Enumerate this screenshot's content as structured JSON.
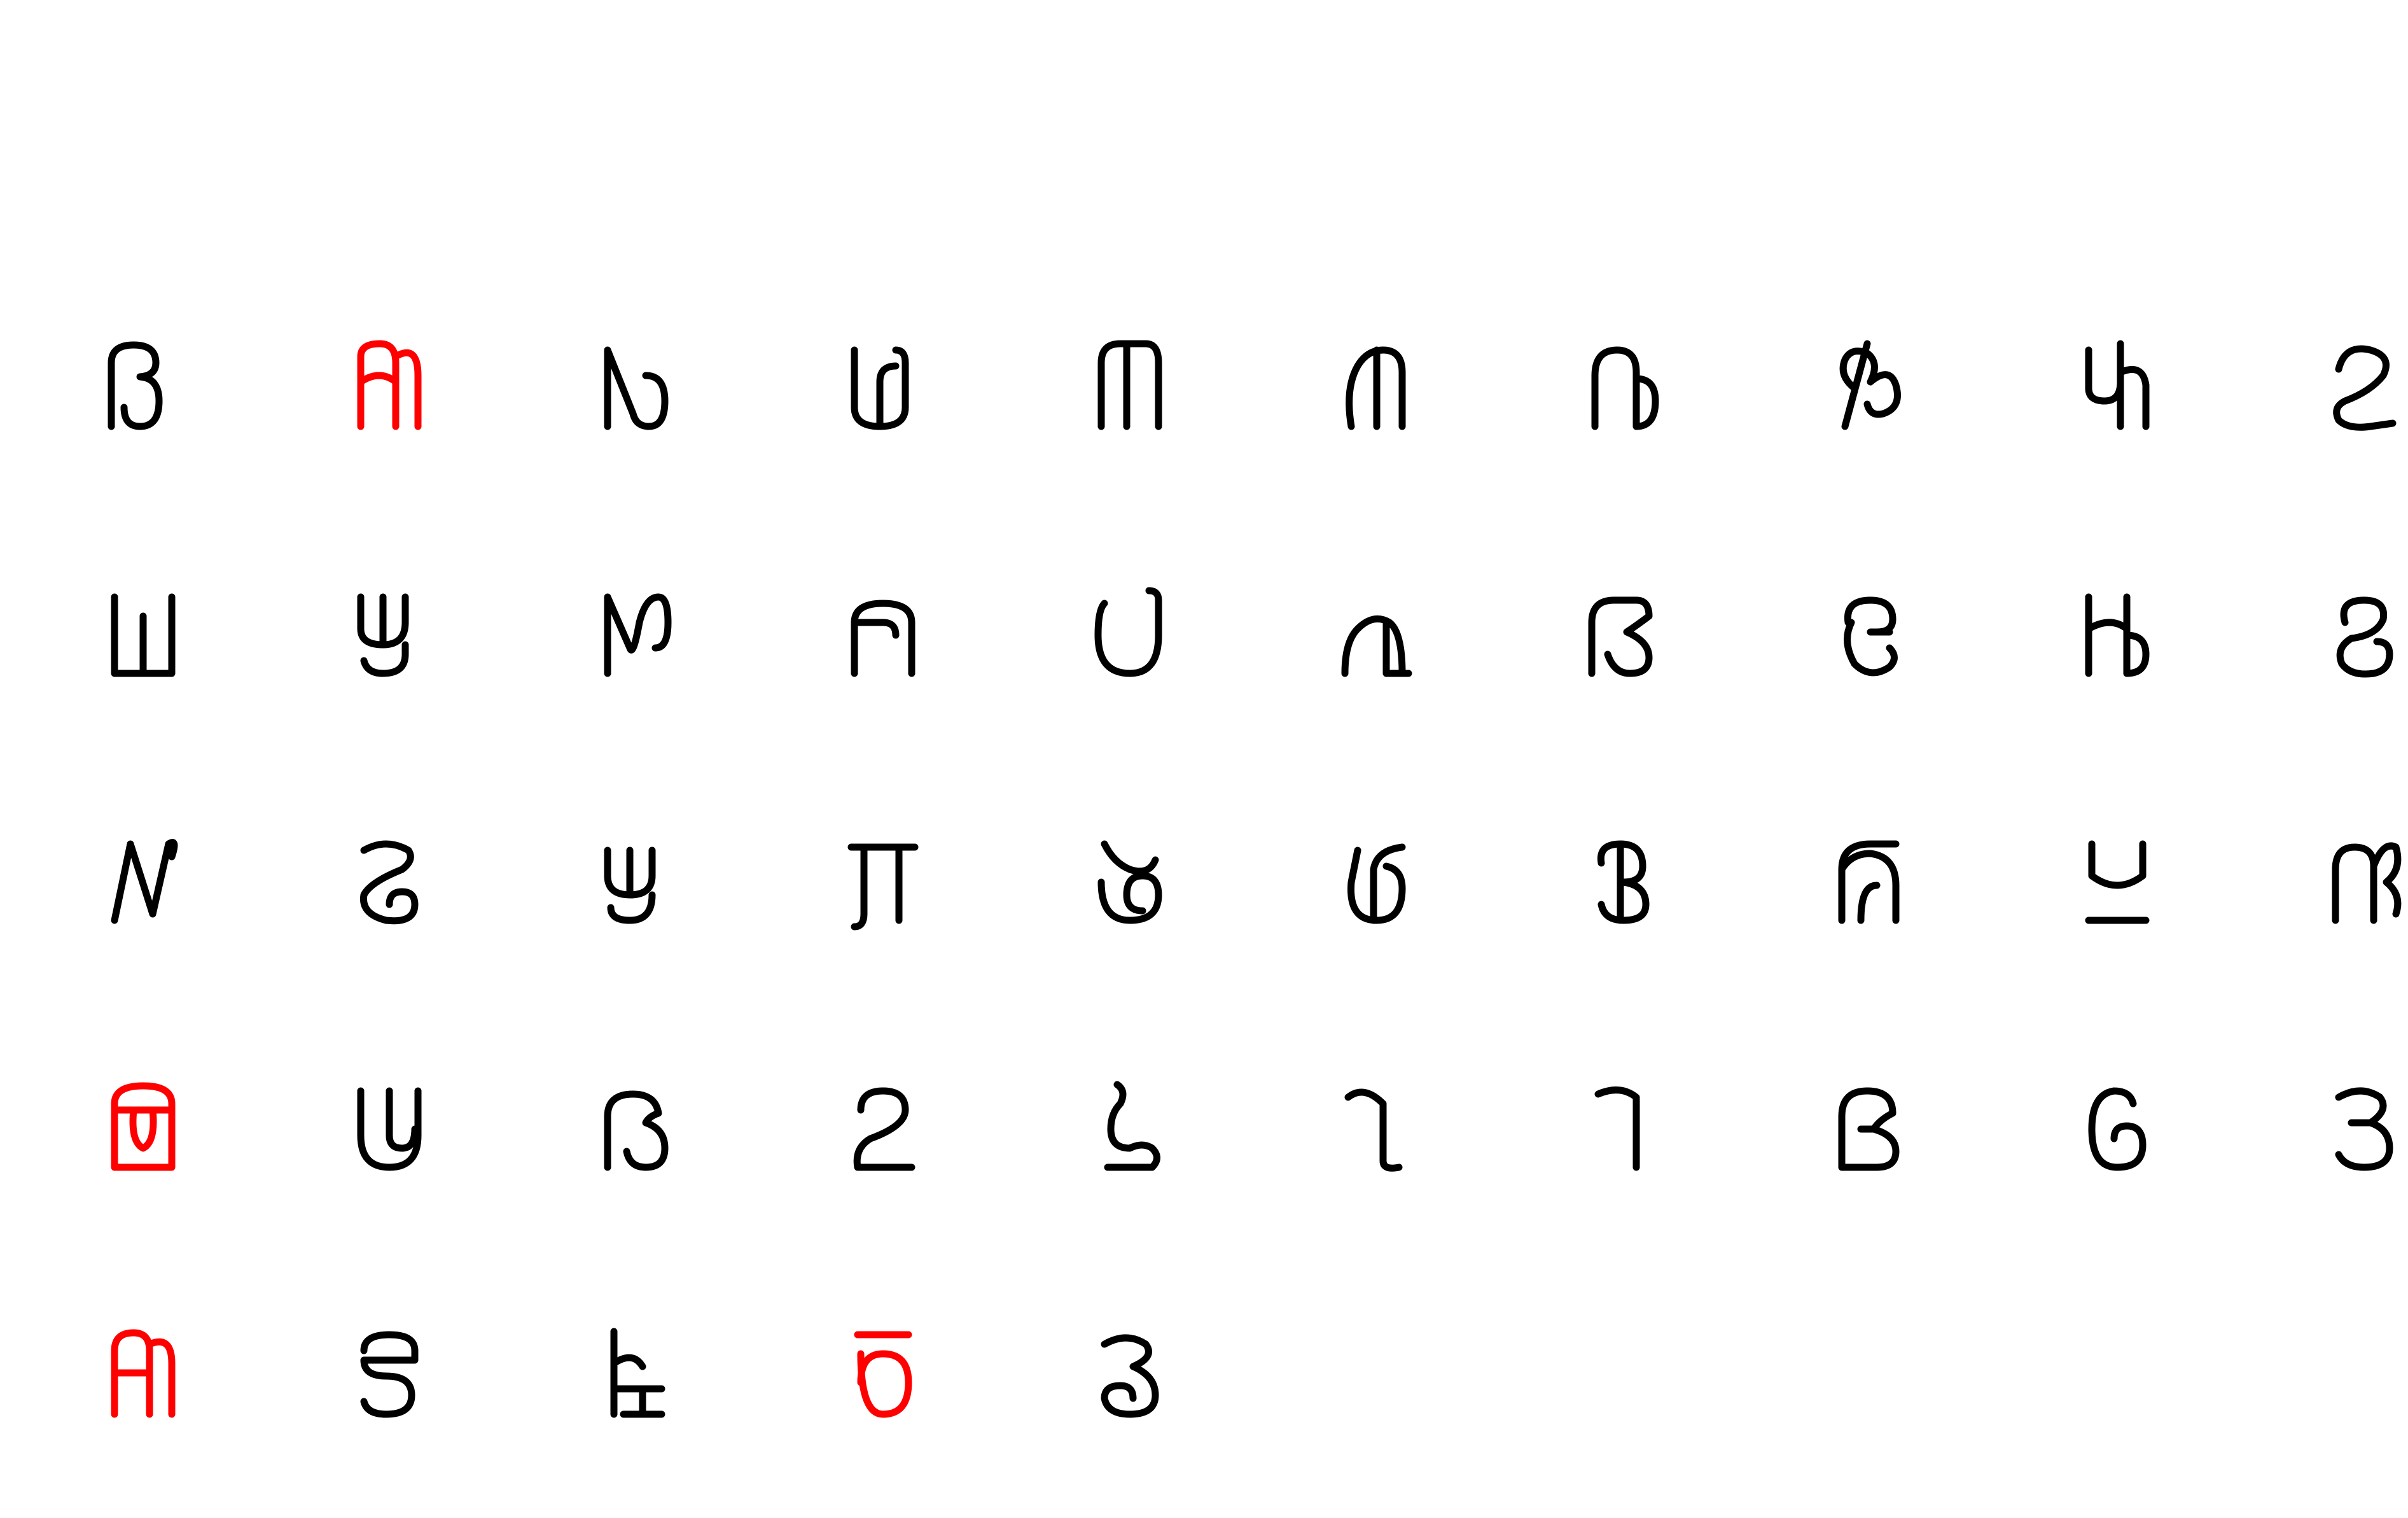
{
  "colors": {
    "background": "#ffffff",
    "default": "#000000",
    "highlight": "#ff0000"
  },
  "glyphs": [
    {
      "icon": "script-glyph-01",
      "color": "#000000"
    },
    {
      "icon": "script-glyph-02",
      "color": "#ff0000"
    },
    {
      "icon": "script-glyph-03",
      "color": "#000000"
    },
    {
      "icon": "script-glyph-04",
      "color": "#000000"
    },
    {
      "icon": "script-glyph-05",
      "color": "#000000"
    },
    {
      "icon": "script-glyph-06",
      "color": "#000000"
    },
    {
      "icon": "script-glyph-07",
      "color": "#000000"
    },
    {
      "icon": "script-glyph-08",
      "color": "#000000"
    },
    {
      "icon": "script-glyph-09",
      "color": "#000000"
    },
    {
      "icon": "script-glyph-10",
      "color": "#000000"
    },
    {
      "icon": "script-glyph-11",
      "color": "#000000"
    },
    {
      "icon": "script-glyph-12",
      "color": "#000000"
    },
    {
      "icon": "script-glyph-13",
      "color": "#000000"
    },
    {
      "icon": "script-glyph-14",
      "color": "#000000"
    },
    {
      "icon": "script-glyph-15",
      "color": "#000000"
    },
    {
      "icon": "script-glyph-16",
      "color": "#000000"
    },
    {
      "icon": "script-glyph-17",
      "color": "#000000"
    },
    {
      "icon": "script-glyph-18",
      "color": "#000000"
    },
    {
      "icon": "script-glyph-19",
      "color": "#000000"
    },
    {
      "icon": "script-glyph-20",
      "color": "#000000"
    },
    {
      "icon": "script-glyph-21",
      "color": "#000000"
    },
    {
      "icon": "script-glyph-22",
      "color": "#000000"
    },
    {
      "icon": "script-glyph-23",
      "color": "#000000"
    },
    {
      "icon": "script-glyph-24",
      "color": "#000000"
    },
    {
      "icon": "script-glyph-25",
      "color": "#000000"
    },
    {
      "icon": "script-glyph-26",
      "color": "#000000"
    },
    {
      "icon": "script-glyph-27",
      "color": "#000000"
    },
    {
      "icon": "script-glyph-28",
      "color": "#000000"
    },
    {
      "icon": "script-glyph-29",
      "color": "#000000"
    },
    {
      "icon": "script-glyph-30",
      "color": "#000000"
    },
    {
      "icon": "script-glyph-31",
      "color": "#ff0000"
    },
    {
      "icon": "script-glyph-32",
      "color": "#000000"
    },
    {
      "icon": "script-glyph-33",
      "color": "#000000"
    },
    {
      "icon": "script-glyph-34",
      "color": "#000000"
    },
    {
      "icon": "script-glyph-35",
      "color": "#000000"
    },
    {
      "icon": "script-glyph-36",
      "color": "#000000"
    },
    {
      "icon": "script-glyph-37",
      "color": "#000000"
    },
    {
      "icon": "script-glyph-38",
      "color": "#000000"
    },
    {
      "icon": "script-glyph-39",
      "color": "#000000"
    },
    {
      "icon": "script-glyph-40",
      "color": "#000000"
    },
    {
      "icon": "script-glyph-41",
      "color": "#ff0000"
    },
    {
      "icon": "script-glyph-42",
      "color": "#000000"
    },
    {
      "icon": "script-glyph-43",
      "color": "#000000"
    },
    {
      "icon": "script-glyph-44",
      "color": "#ff0000"
    },
    {
      "icon": "script-glyph-45",
      "color": "#000000"
    }
  ]
}
